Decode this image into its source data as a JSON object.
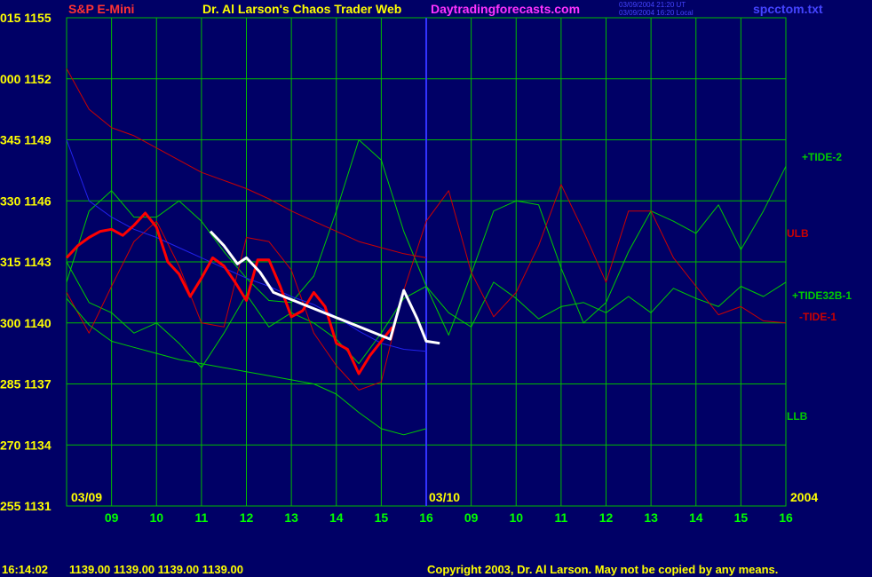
{
  "header": {
    "symbol": "S&P E-Mini",
    "title": "Dr. Al Larson's Chaos Trader Web",
    "site": "Daytradingforecasts.com",
    "stamp_utc": "03/09/2004 21:20 UT",
    "stamp_local": "03/09/2004 16:20 Local",
    "file": "spcctom.txt"
  },
  "footer": {
    "time": "16:14:02",
    "quote": "1139.00 1139.00 1139.00 1139.00",
    "copyright": "Copyright 2003, Dr. Al Larson. May not be copied by any means."
  },
  "colors": {
    "background": "#000066",
    "grid": "#00bb00",
    "divider": "#3333ff",
    "price_up": "#ff0000",
    "forecast": "#ffffff",
    "tide2": "#00cc00",
    "tide32b": "#00cc00",
    "tide1": "#cc0000",
    "ulb": "#cc0000",
    "llb": "#00cc00",
    "blue_line": "#2222ee",
    "yellow_avg": "#ffff66"
  },
  "chart_data": {
    "type": "line",
    "ylim": [
      1131,
      1155
    ],
    "y_ticks": [
      {
        "left": "015",
        "price": "1155"
      },
      {
        "left": "000",
        "price": "1152"
      },
      {
        "left": "345",
        "price": "1149"
      },
      {
        "left": "330",
        "price": "1146"
      },
      {
        "left": "315",
        "price": "1143"
      },
      {
        "left": "300",
        "price": "1140"
      },
      {
        "left": "285",
        "price": "1137"
      },
      {
        "left": "270",
        "price": "1134"
      },
      {
        "left": "255",
        "price": "1131"
      }
    ],
    "x_tick_labels": [
      "09",
      "10",
      "11",
      "12",
      "13",
      "14",
      "15",
      "16",
      "09",
      "10",
      "11",
      "12",
      "13",
      "14",
      "15",
      "16"
    ],
    "date_labels": [
      "03/09",
      "03/10"
    ],
    "year_label": "2004",
    "series": [
      {
        "name": "+TIDE-2",
        "color": "#00cc00",
        "x": [
          8,
          8.5,
          9,
          9.5,
          10,
          10.5,
          11,
          11.5,
          12,
          12.5,
          13,
          13.5,
          14,
          14.5,
          15,
          15.5,
          16,
          16.5,
          17,
          17.5,
          18,
          18.5,
          19,
          19.5,
          20,
          20.5,
          21,
          21.5,
          22,
          22.5,
          23,
          23.5,
          24
        ],
        "y": [
          1142,
          1145.5,
          1146.5,
          1145.2,
          1145.2,
          1146,
          1145,
          1143.5,
          1142.2,
          1141.1,
          1141,
          1142.3,
          1145.5,
          1149,
          1148,
          1144.5,
          1141.8,
          1139.4,
          1142.4,
          1145.5,
          1146,
          1145.8,
          1142.7,
          1140,
          1141,
          1143.5,
          1145.5,
          1145,
          1144.4,
          1145.8,
          1143.6,
          1145.5,
          1147.7
        ]
      },
      {
        "name": "+TIDE32B-1",
        "color": "#00cc00",
        "x": [
          8,
          8.5,
          9,
          9.5,
          10,
          10.5,
          11,
          11.5,
          12,
          12.5,
          13,
          13.5,
          14,
          14.5,
          15,
          15.5,
          16,
          16.5,
          17,
          17.5,
          18,
          18.5,
          19,
          19.5,
          20,
          20.5,
          21,
          21.5,
          22,
          22.5,
          23,
          23.5,
          24
        ],
        "y": [
          1143,
          1141,
          1140.5,
          1139.5,
          1140,
          1139,
          1137.8,
          1139.5,
          1141.4,
          1139.8,
          1140.5,
          1140,
          1139.2,
          1138,
          1139.5,
          1141.2,
          1141.8,
          1140.5,
          1139.8,
          1142,
          1141.2,
          1140.2,
          1140.8,
          1141,
          1140.5,
          1141.3,
          1140.5,
          1141.7,
          1141.2,
          1140.8,
          1141.8,
          1141.3,
          1142
        ]
      },
      {
        "name": "-TIDE-1",
        "color": "#cc0000",
        "x": [
          8,
          8.5,
          9,
          9.5,
          10,
          10.5,
          11,
          11.5,
          12,
          12.5,
          13,
          13.5,
          14,
          14.5,
          15,
          15.5,
          16,
          16.5,
          17,
          17.5,
          18,
          18.5,
          19,
          19.5,
          20,
          20.5,
          21,
          21.5,
          22,
          22.5,
          23,
          23.5,
          24
        ],
        "y": [
          1141.5,
          1139.5,
          1141.8,
          1144,
          1145,
          1142.8,
          1140,
          1139.8,
          1144.2,
          1144,
          1142.6,
          1139.5,
          1137.9,
          1136.7,
          1137.1,
          1141.6,
          1145,
          1146.5,
          1142.5,
          1140.3,
          1141.5,
          1143.8,
          1146.8,
          1144.5,
          1142,
          1145.5,
          1145.5,
          1143.2,
          1141.8,
          1140.4,
          1140.8,
          1140.1,
          1140
        ]
      },
      {
        "name": "ULB",
        "color": "#cc0000",
        "x": [
          8,
          8.5,
          9,
          9.5,
          10,
          10.5,
          11,
          11.5,
          12,
          12.5,
          13,
          13.5,
          14,
          14.5,
          15,
          15.5,
          16
        ],
        "y": [
          1152.5,
          1150.5,
          1149.6,
          1149.2,
          1148.6,
          1148,
          1147.4,
          1147,
          1146.6,
          1146.1,
          1145.5,
          1145,
          1144.5,
          1144,
          1143.7,
          1143.4,
          1143.2
        ]
      },
      {
        "name": "LLB",
        "color": "#00cc00",
        "x": [
          8,
          8.5,
          9,
          9.5,
          10,
          10.5,
          11,
          11.5,
          12,
          12.5,
          13,
          13.5,
          14,
          14.5,
          15,
          15.5,
          16
        ],
        "y": [
          1141.2,
          1139.9,
          1139.1,
          1138.8,
          1138.5,
          1138.2,
          1138,
          1137.8,
          1137.6,
          1137.4,
          1137.2,
          1137,
          1136.5,
          1135.6,
          1134.8,
          1134.5,
          1134.8
        ]
      },
      {
        "name": "blue",
        "color": "#2222ee",
        "x": [
          8,
          8.5,
          9,
          9.5,
          10,
          10.5,
          11,
          11.5,
          12,
          12.5,
          13,
          13.5,
          14,
          14.5,
          15,
          15.5,
          16
        ],
        "y": [
          1149,
          1146,
          1145.2,
          1144.6,
          1144.2,
          1143.7,
          1143.2,
          1142.7,
          1142.2,
          1141.8,
          1141.3,
          1140.9,
          1140.3,
          1139.6,
          1139,
          1138.7,
          1138.6
        ]
      },
      {
        "name": "price",
        "color": "#ff0000",
        "x": [
          8,
          8.25,
          8.5,
          8.75,
          9,
          9.25,
          9.5,
          9.75,
          10,
          10.25,
          10.5,
          10.75,
          11,
          11.25,
          11.5,
          11.75,
          12,
          12.25,
          12.5,
          12.75,
          13,
          13.25,
          13.5,
          13.75,
          14,
          14.25,
          14.5,
          14.75,
          15,
          15.25
        ],
        "y": [
          1143.2,
          1143.8,
          1144.2,
          1144.5,
          1144.6,
          1144.3,
          1144.8,
          1145.4,
          1144.7,
          1143,
          1142.4,
          1141.3,
          1142.2,
          1143.2,
          1142.8,
          1142,
          1141.1,
          1143.1,
          1143.1,
          1141.8,
          1140.3,
          1140.6,
          1141.5,
          1140.8,
          1139,
          1138.7,
          1137.5,
          1138.4,
          1139.1,
          1139.8
        ]
      },
      {
        "name": "forecast",
        "color": "#ffffff",
        "x": [
          11.2,
          11.5,
          11.8,
          12,
          12.3,
          12.6,
          15.2,
          15.5,
          15.8,
          16,
          16.3
        ],
        "y": [
          1144.5,
          1143.8,
          1142.9,
          1143.2,
          1142.5,
          1141.5,
          1139.2,
          1141.6,
          1140.2,
          1139.1,
          1139
        ]
      }
    ],
    "annotations": [
      "+TIDE-2",
      "ULB",
      "+TIDE32B-1",
      "-TIDE-1",
      "LLB"
    ]
  }
}
